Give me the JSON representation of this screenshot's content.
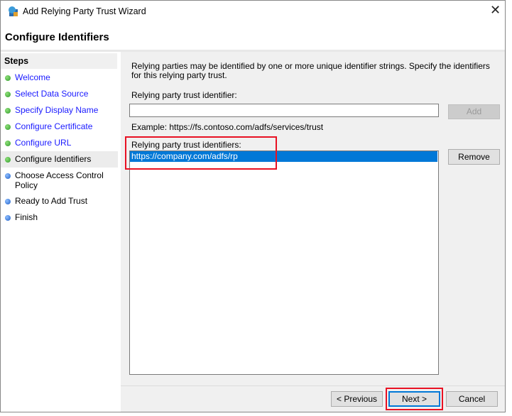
{
  "window": {
    "title": "Add Relying Party Trust Wizard",
    "close": "✕"
  },
  "header": {
    "title": "Configure Identifiers"
  },
  "steps": {
    "title": "Steps",
    "items": [
      {
        "label": "Welcome",
        "state": "done"
      },
      {
        "label": "Select Data Source",
        "state": "done"
      },
      {
        "label": "Specify Display Name",
        "state": "done"
      },
      {
        "label": "Configure Certificate",
        "state": "done"
      },
      {
        "label": "Configure URL",
        "state": "done"
      },
      {
        "label": "Configure Identifiers",
        "state": "current"
      },
      {
        "label": "Choose Access Control Policy",
        "state": "todo"
      },
      {
        "label": "Ready to Add Trust",
        "state": "todo"
      },
      {
        "label": "Finish",
        "state": "todo"
      }
    ]
  },
  "main": {
    "description": "Relying parties may be identified by one or more unique identifier strings. Specify the identifiers for this relying party trust.",
    "identifier_label": "Relying party trust identifier:",
    "identifier_value": "",
    "add_label": "Add",
    "example": "Example: https://fs.contoso.com/adfs/services/trust",
    "identifiers_label": "Relying party trust identifiers:",
    "identifiers": [
      "https://company.com/adfs/rp"
    ],
    "remove_label": "Remove"
  },
  "footer": {
    "previous": "< Previous",
    "next": "Next >",
    "cancel": "Cancel"
  },
  "colors": {
    "selection": "#0078d7",
    "highlight": "#e81123",
    "link": "#1a1aff"
  }
}
